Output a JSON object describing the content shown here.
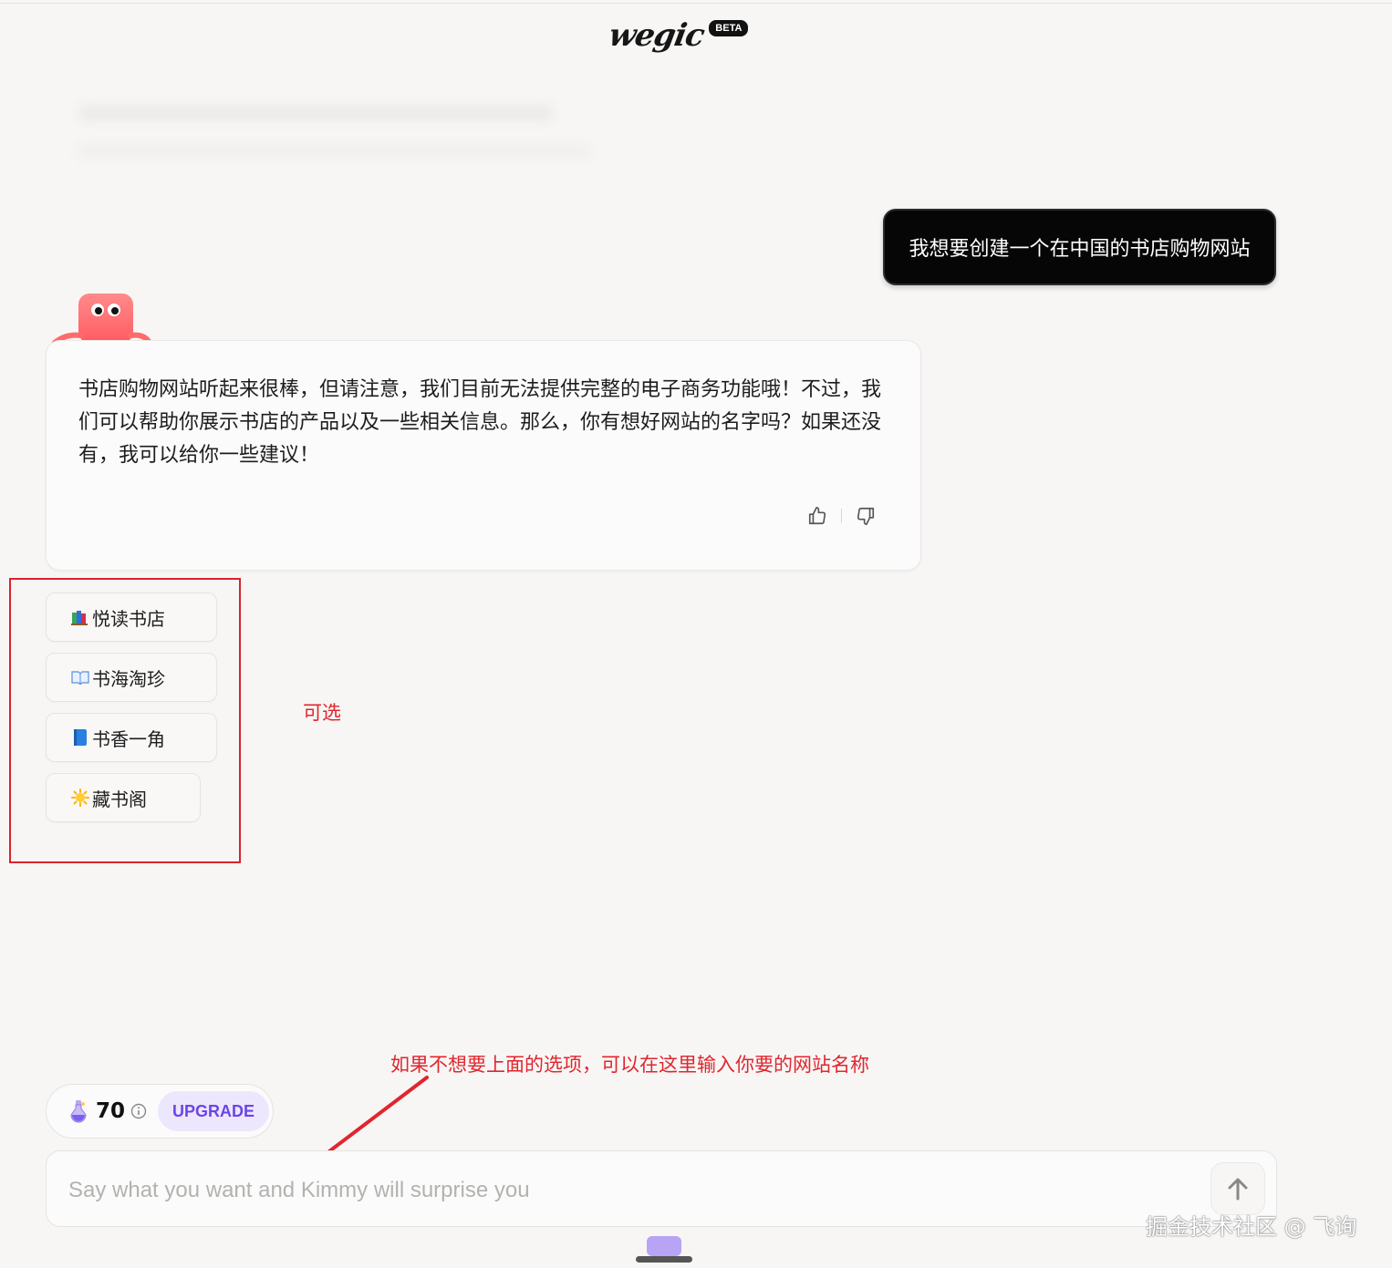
{
  "app": {
    "logo_text": "wegic",
    "badge": "BETA"
  },
  "chat": {
    "user_message": "我想要创建一个在中国的书店购物网站",
    "assistant_message": "书店购物网站听起来很棒，但请注意，我们目前无法提供完整的电子商务功能哦！不过，我们可以帮助你展示书店的产品以及一些相关信息。那么，你有想好网站的名字吗？如果还没有，我可以给你一些建议！",
    "options": [
      {
        "label": "悦读书店",
        "icon": "books-icon"
      },
      {
        "label": "书海淘珍",
        "icon": "open-book-icon"
      },
      {
        "label": "书香一角",
        "icon": "blue-book-icon"
      },
      {
        "label": "藏书阁",
        "icon": "sparkle-icon"
      }
    ]
  },
  "annotations": {
    "optional_note": "可选",
    "input_note": "如果不想要上面的选项，可以在这里输入你要的网站名称"
  },
  "credits": {
    "count": "70",
    "upgrade_label": "UPGRADE"
  },
  "input": {
    "placeholder": "Say what you want and Kimmy will surprise you"
  },
  "watermark": "掘金技术社区 @ 飞询",
  "colors": {
    "accent": "#6c45e6",
    "annotation": "#e0262e",
    "mascot": "#ff6b6b"
  }
}
